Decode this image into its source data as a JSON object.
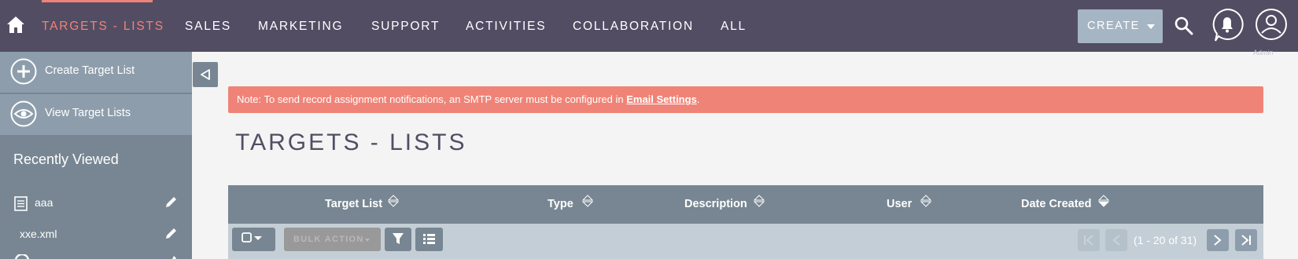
{
  "nav": {
    "items": [
      {
        "label": "TARGETS - LISTS",
        "active": true
      },
      {
        "label": "SALES"
      },
      {
        "label": "MARKETING"
      },
      {
        "label": "SUPPORT"
      },
      {
        "label": "ACTIVITIES"
      },
      {
        "label": "COLLABORATION"
      },
      {
        "label": "ALL"
      }
    ],
    "create_label": "CREATE",
    "user_sub": "Admin"
  },
  "sidebar": {
    "actions": [
      {
        "label": "Create Target List",
        "icon": "plus-icon"
      },
      {
        "label": "View Target Lists",
        "icon": "eye-icon"
      }
    ],
    "recent_title": "Recently Viewed",
    "recent": [
      {
        "label": "aaa"
      },
      {
        "label": "xxe.xml"
      }
    ]
  },
  "alert": {
    "prefix": "Note: To send record assignment notifications, an SMTP server must be configured in ",
    "link": "Email Settings",
    "suffix": "."
  },
  "page_title": "TARGETS - LISTS",
  "table": {
    "columns": [
      "Target List",
      "Type",
      "Description",
      "User",
      "Date Created"
    ],
    "bulk_action": "BULK ACTION",
    "pagination": "(1 - 20 of 31)"
  },
  "colors": {
    "nav_bg": "#534d64",
    "accent": "#f08377",
    "sidebar_bg": "#778692",
    "table_header": "#778692",
    "toolbar_bg": "#c4ced6"
  }
}
